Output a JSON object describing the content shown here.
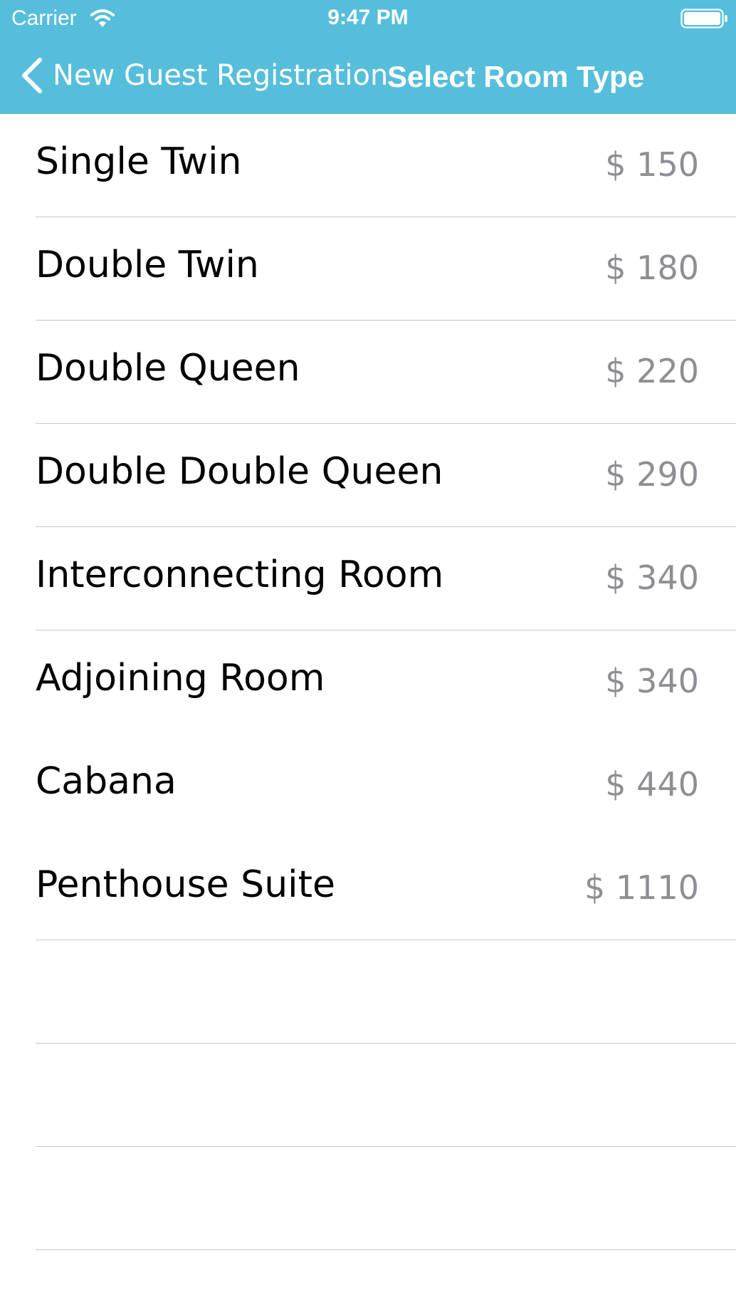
{
  "status_bar": {
    "carrier": "Carrier",
    "time": "9:47 PM"
  },
  "nav": {
    "back_label": "New Guest Registration",
    "title": "Select Room Type"
  },
  "rooms": [
    {
      "name": "Single Twin",
      "price": "$ 150"
    },
    {
      "name": "Double Twin",
      "price": "$ 180"
    },
    {
      "name": "Double Queen",
      "price": "$ 220"
    },
    {
      "name": "Double Double Queen",
      "price": "$ 290"
    },
    {
      "name": "Interconnecting Room",
      "price": "$ 340"
    },
    {
      "name": "Adjoining Room",
      "price": "$ 340"
    },
    {
      "name": "Cabana",
      "price": "$ 440"
    },
    {
      "name": "Penthouse Suite",
      "price": "$ 1110"
    }
  ],
  "colors": {
    "nav_background": "#56bedb",
    "price_text": "#8e8e93",
    "separator": "#c8c7cc"
  }
}
